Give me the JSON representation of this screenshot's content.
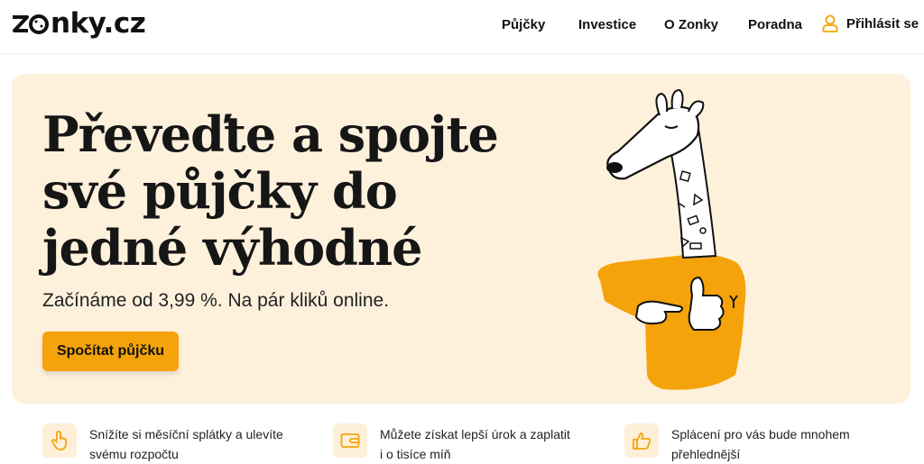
{
  "header": {
    "logo": "zonky.cz",
    "logo_rest": "nky.cz",
    "nav": [
      "Půjčky",
      "Investice",
      "O Zonky",
      "Poradna"
    ],
    "login_label": "Přihlásit se"
  },
  "hero": {
    "title_lines": [
      "Převeďte a spojte",
      "své půjčky do",
      "jedné výhodné"
    ],
    "subtitle": "Začínáme od 3,99 %. Na pár kliků online.",
    "cta_label": "Spočítat půjčku"
  },
  "features": [
    {
      "icon": "pointer-hand-icon",
      "lines": [
        "Snížíte si měsíční splátky a ulevíte",
        "svému rozpočtu"
      ]
    },
    {
      "icon": "wallet-icon",
      "lines": [
        "Můžete získat lepší úrok a zaplatit",
        "i o tisíce míň"
      ]
    },
    {
      "icon": "thumbs-up-icon",
      "lines": [
        "Splácení pro vás bude mnohem",
        "přehlednější"
      ]
    }
  ],
  "colors": {
    "accent": "#f5a30a",
    "hero_bg": "#fdf1dc",
    "icon_bg": "#fdefd8"
  }
}
